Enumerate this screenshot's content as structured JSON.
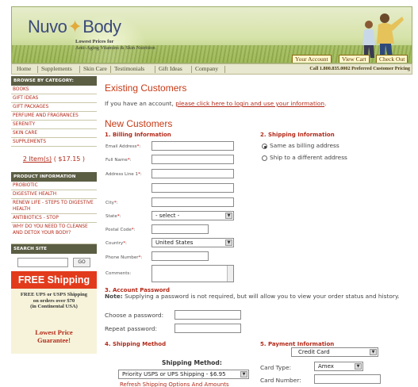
{
  "header": {
    "logo_left": "Nuvo",
    "logo_right": "Body",
    "tagline_line1": "Lowest Prices for",
    "tagline_line2": "Anti-Aging Vitamins & Skin Nutrition",
    "btn_account": "Your Account",
    "btn_cart": "View Cart",
    "btn_checkout": "Check Out"
  },
  "nav": {
    "items": [
      "Home",
      "Supplements",
      "Skin Care",
      "Testimonials",
      "Gift Ideas",
      "Company"
    ],
    "phone": "Call 1.800.835.0002 Preferred Customer Pricing"
  },
  "sidebar": {
    "browse_heading": "BROWSE BY CATEGORY:",
    "categories": [
      "BOOKS",
      "GIFT IDEAS",
      "GIFT PACKAGES",
      "PERFUME AND FRAGRANCES",
      "SERENITY",
      "SKIN CARE",
      "SUPPLEMENTS"
    ],
    "cart_items": "2 Item(s)",
    "cart_total": "( $17.15 )",
    "product_heading": "PRODUCT INFORMATION",
    "products": [
      "PROBIOTIC",
      "DIGESTIVE HEALTH",
      "RENEW LIFE - STEPS TO DIGESTIVE HEALTH",
      "ANTIBIOTICS - STOP",
      "WHY DO YOU NEED TO CLEANSE AND DETOX YOUR BODY?"
    ],
    "search_heading": "SEARCH SITE",
    "search_go": "GO",
    "free_shipping": "FREE Shipping",
    "free_ship_line1": "FREE UPS or USPS Shipping",
    "free_ship_line2": "on orders over $70",
    "free_ship_line3": "(in Continental USA)",
    "lowest_price_1": "Lowest Price",
    "lowest_price_2": "Guarantee!"
  },
  "main": {
    "existing_title": "Existing Customers",
    "existing_text": "If you have an account, ",
    "existing_link": "please click here to login and use your information",
    "existing_end": ".",
    "new_title": "New Customers",
    "billing_title": "1. Billing Information",
    "billing_labels": [
      "Email Address",
      "Full Name",
      "Address Line 1",
      "City",
      "State",
      "Postal Code",
      "Country",
      "Phone Number",
      "Comments"
    ],
    "state_value": "- select -",
    "country_value": "United States",
    "shipping_info_title": "2. Shipping Information",
    "ship_same": "Same as billing address",
    "ship_different": "Ship to a different address",
    "password_title": "3. Account Password",
    "password_note_bold": "Note:",
    "password_note": " Supplying a password is not required, but will allow you to view your order status and history.",
    "choose_password": "Choose a password:",
    "repeat_password": "Repeat password:",
    "shipping_method_title": "4. Shipping Method",
    "shipping_method_label": "Shipping Method:",
    "shipping_method_value": "Priority USPS or UPS Shipping - $6.95",
    "refresh_link": "Refresh Shipping Options And Amounts",
    "payment_title": "5. Payment Information",
    "payment_method": "Credit Card",
    "card_type_label": "Card Type:",
    "card_type_value": "Amex",
    "card_number_label": "Card Number:"
  }
}
